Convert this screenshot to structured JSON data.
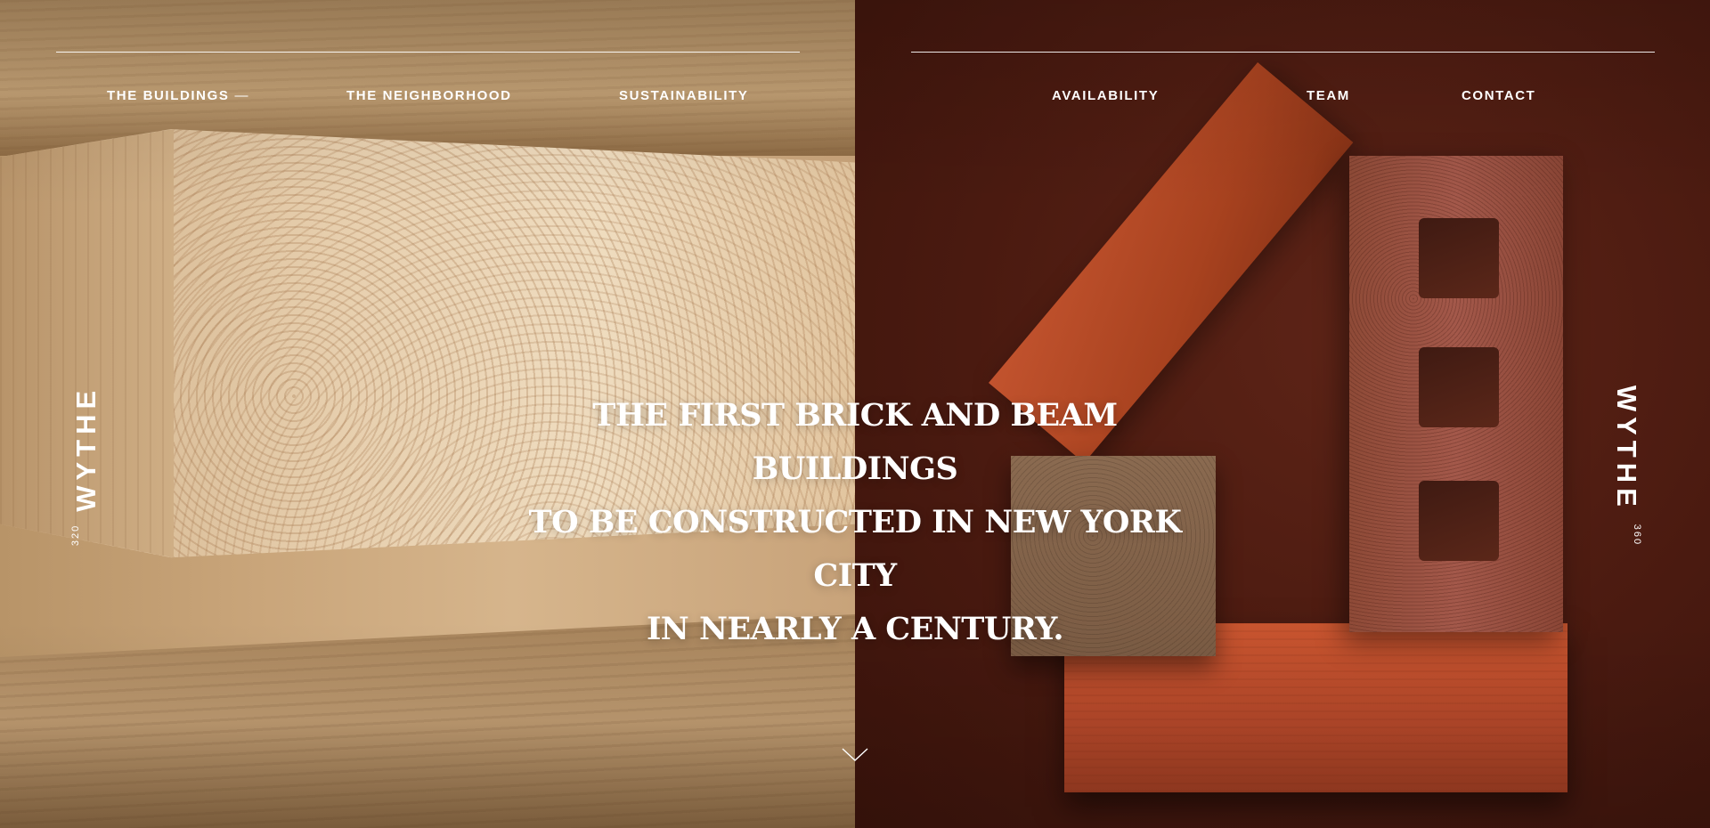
{
  "nav": {
    "left": [
      {
        "label": "THE BUILDINGS",
        "suffix": "—"
      },
      {
        "label": "THE NEIGHBORHOOD"
      },
      {
        "label": "SUSTAINABILITY"
      }
    ],
    "right": [
      {
        "label": "AVAILABILITY"
      },
      {
        "label": "TEAM"
      },
      {
        "label": "CONTACT"
      }
    ]
  },
  "buildings": {
    "left": {
      "number": "320",
      "name": "WYTHE"
    },
    "right": {
      "number": "360",
      "name": "WYTHE"
    }
  },
  "headline": {
    "line1": "THE FIRST BRICK AND BEAM BUILDINGS",
    "line2": "TO BE CONSTRUCTED IN NEW YORK CITY",
    "line3": "IN NEARLY A CENTURY."
  },
  "icons": {
    "scroll": "chevron-down-icon"
  },
  "colors": {
    "text": "#ffffff",
    "timber": "#d6b58c",
    "brick": "#b5482a",
    "background_right": "#4a1a10"
  }
}
